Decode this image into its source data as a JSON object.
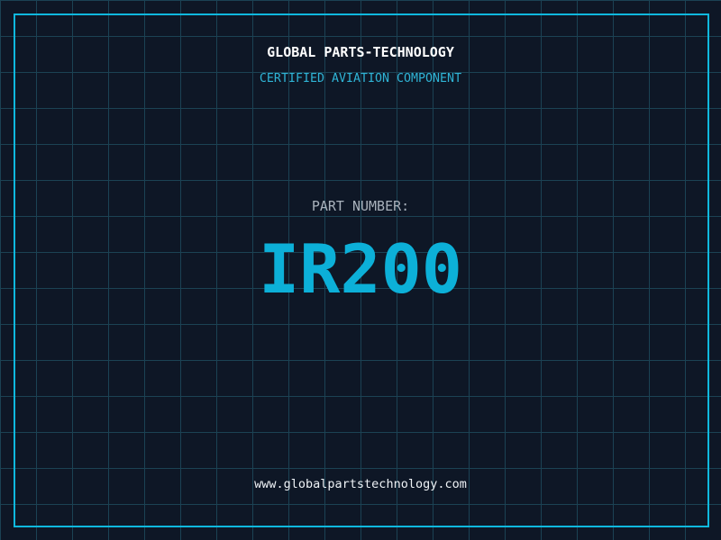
{
  "theme": {
    "background": "#0e1726",
    "grid_line": "#1b4254",
    "frame": "#0fb8de",
    "title_color": "#ffffff",
    "subtitle_color": "#2fb4d6",
    "label_color": "#a9b2bc",
    "part_number_color": "#0cb0d8",
    "footer_color": "#eef2f6"
  },
  "header": {
    "company": "GLOBAL PARTS-TECHNOLOGY",
    "certification": "CERTIFIED AVIATION COMPONENT"
  },
  "part": {
    "label": "PART NUMBER:",
    "number": "IR200"
  },
  "footer": {
    "website": "www.globalpartstechnology.com"
  }
}
